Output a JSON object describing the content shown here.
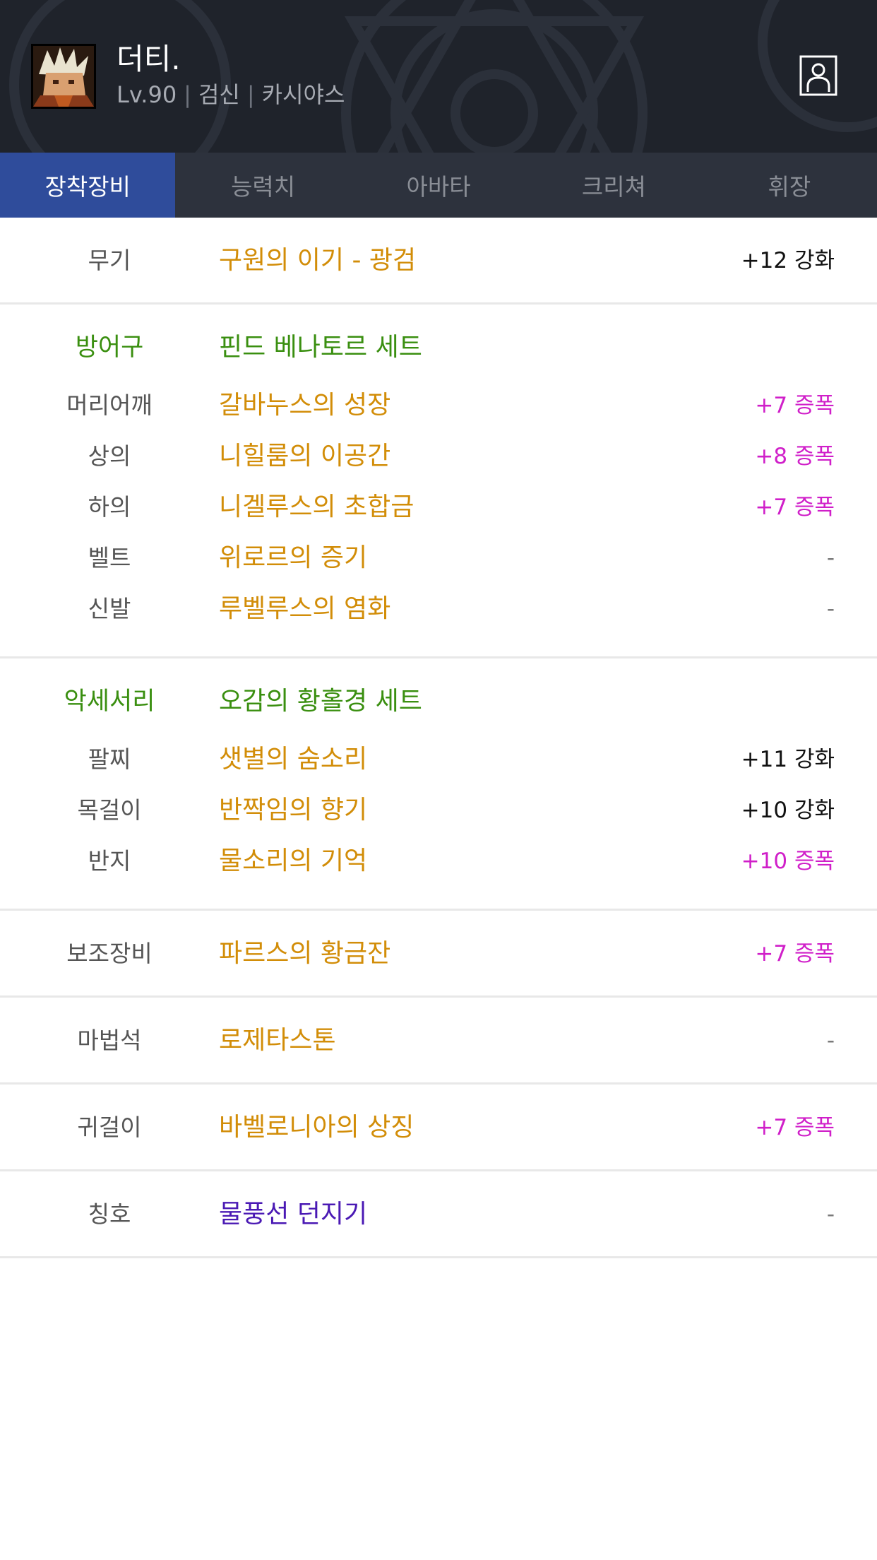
{
  "character": {
    "name": "더티.",
    "level": "Lv.90",
    "job": "검신",
    "server": "카시야스"
  },
  "tabs": [
    {
      "label": "장착장비",
      "active": true
    },
    {
      "label": "능력치",
      "active": false
    },
    {
      "label": "아바타",
      "active": false
    },
    {
      "label": "크리쳐",
      "active": false
    },
    {
      "label": "휘장",
      "active": false
    }
  ],
  "weapon": {
    "slot": "무기",
    "name": "구원의 이기 - 광검",
    "upgrade": "+12 강화"
  },
  "armor": {
    "label": "방어구",
    "set_name": "핀드 베나토르 세트",
    "items": [
      {
        "slot": "머리어깨",
        "name": "갈바누스의 성장",
        "upgrade": "+7 증폭"
      },
      {
        "slot": "상의",
        "name": "니힐룸의 이공간",
        "upgrade": "+8 증폭"
      },
      {
        "slot": "하의",
        "name": "니겔루스의 초합금",
        "upgrade": "+7 증폭"
      },
      {
        "slot": "벨트",
        "name": "위로르의 증기",
        "upgrade": "-"
      },
      {
        "slot": "신발",
        "name": "루벨루스의 염화",
        "upgrade": "-"
      }
    ]
  },
  "accessory": {
    "label": "악세서리",
    "set_name": "오감의 황홀경 세트",
    "items": [
      {
        "slot": "팔찌",
        "name": "샛별의 숨소리",
        "upgrade": "+11 강화"
      },
      {
        "slot": "목걸이",
        "name": "반짝임의 향기",
        "upgrade": "+10 강화"
      },
      {
        "slot": "반지",
        "name": "물소리의 기억",
        "upgrade": "+10 증폭"
      }
    ]
  },
  "sub_equipment": {
    "slot": "보조장비",
    "name": "파르스의 황금잔",
    "upgrade": "+7 증폭"
  },
  "magic_stone": {
    "slot": "마법석",
    "name": "로제타스톤",
    "upgrade": "-"
  },
  "earring": {
    "slot": "귀걸이",
    "name": "바벨로니아의 상징",
    "upgrade": "+7 증폭"
  },
  "title": {
    "slot": "칭호",
    "name": "물풍선 던지기",
    "upgrade": "-"
  },
  "colors": {
    "header_bg": "#1f232b",
    "tab_bar_bg": "#2d323d",
    "tab_active_bg": "#2f4c9b",
    "item_orange": "#d28d08",
    "set_green": "#3a8f10",
    "amplify_magenta": "#d01fc9",
    "title_purple": "#4a19b4"
  },
  "icons": {
    "profile": "person-outline-icon",
    "avatar": "character-portrait"
  }
}
